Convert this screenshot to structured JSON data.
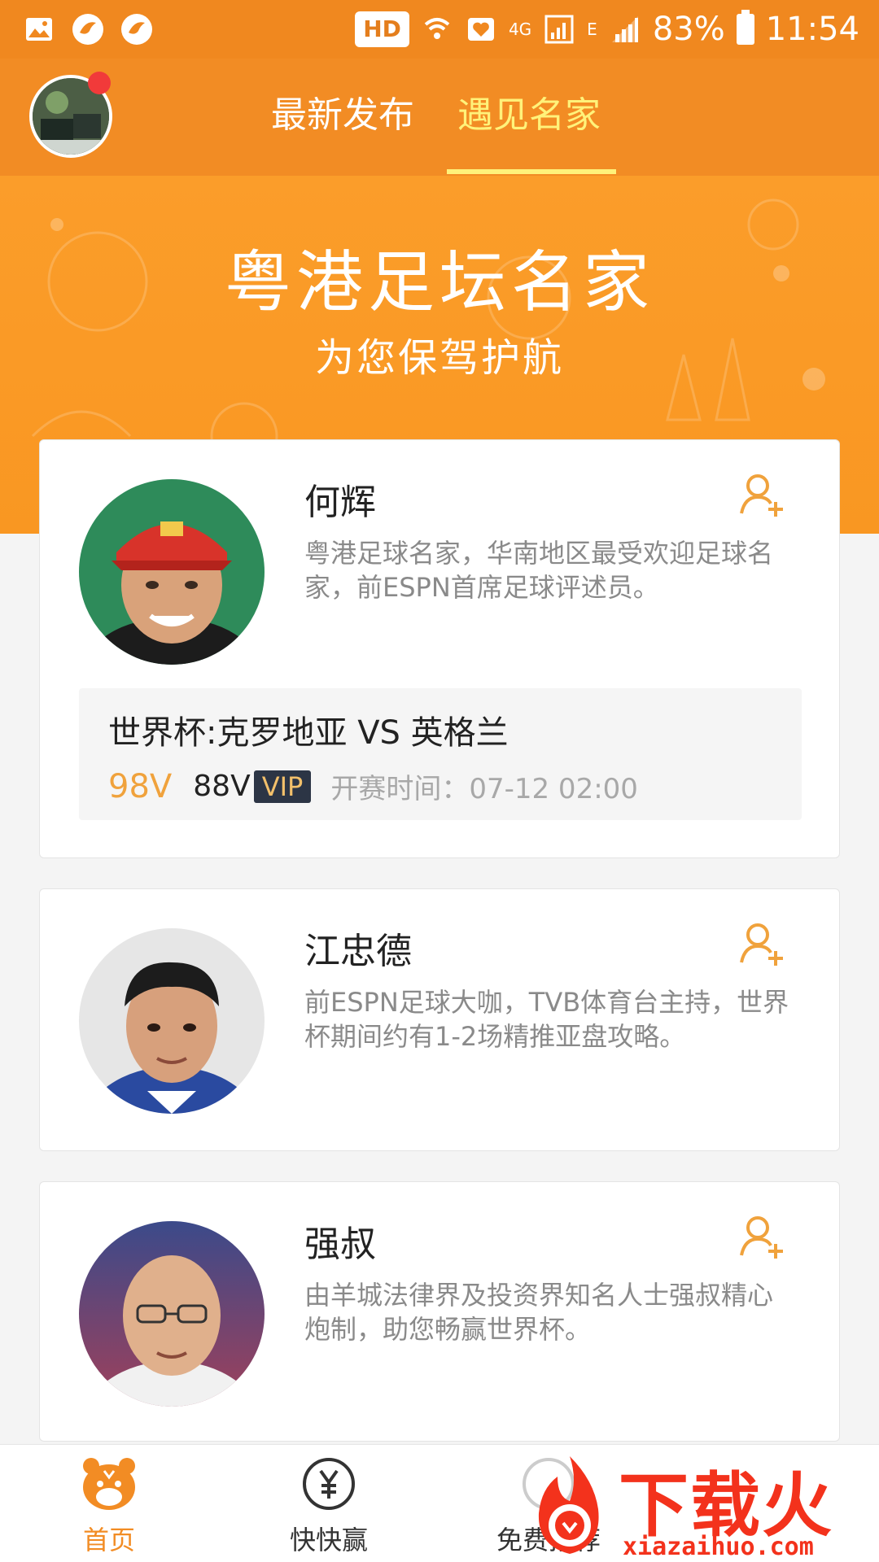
{
  "status_bar": {
    "hd": "HD",
    "network_4g": "4G",
    "network_e": "E",
    "battery": "83%",
    "time": "11:54"
  },
  "top_nav": {
    "tabs": [
      {
        "label": "最新发布",
        "active": false
      },
      {
        "label": "遇见名家",
        "active": true
      }
    ]
  },
  "banner": {
    "title": "粤港足坛名家",
    "subtitle": "为您保驾护航"
  },
  "experts": [
    {
      "name": "何辉",
      "description": "粤港足球名家，华南地区最受欢迎足球名家，前ESPN首席足球评述员。",
      "match": {
        "title": "世界杯:克罗地亚 VS 英格兰",
        "price_original": "98V",
        "price_vip": "88V",
        "vip_label": "VIP",
        "start_time": "开赛时间：07-12 02:00"
      }
    },
    {
      "name": "江忠德",
      "description": "前ESPN足球大咖，TVB体育台主持，世界杯期间约有1-2场精推亚盘攻略。"
    },
    {
      "name": "强叔",
      "description": "由羊城法律界及投资界知名人士强叔精心炮制，助您畅赢世界杯。"
    }
  ],
  "bottom_nav": {
    "items": [
      {
        "label": "首页",
        "icon": "tiger-icon",
        "active": true
      },
      {
        "label": "快快赢",
        "icon": "yen-coin-icon",
        "active": false
      },
      {
        "label": "免费推荐",
        "icon": "free-icon",
        "active": false
      }
    ]
  },
  "watermark": {
    "text": "下载火",
    "url": "xiazaihuo.com"
  },
  "colors": {
    "brand_orange": "#f28c24",
    "active_tab": "#fff27a",
    "price_orange": "#f0a23c",
    "vip_badge_bg": "#2c3545"
  }
}
